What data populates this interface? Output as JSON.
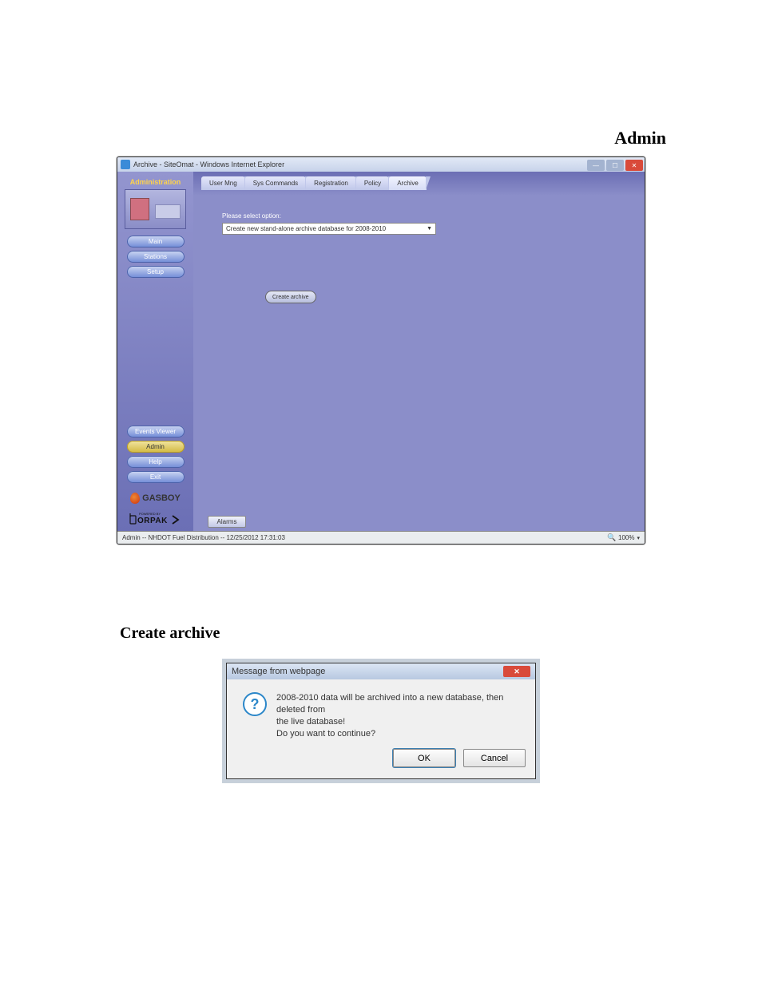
{
  "doc": {
    "section_admin": "Admin",
    "section_create": "Create archive"
  },
  "win": {
    "title": "Archive - SiteOmat - Windows Internet Explorer",
    "sidebar": {
      "heading": "Administration",
      "buttons": {
        "main": "Main",
        "stations": "Stations",
        "setup": "Setup",
        "events": "Events Viewer",
        "admin": "Admin",
        "help": "Help",
        "exit": "Exit"
      },
      "brand": "GASBOY",
      "powered": "POWERED BY",
      "orpak": "ORPAK"
    },
    "tabs": {
      "usermng": "User Mng",
      "syscmd": "Sys Commands",
      "reg": "Registration",
      "policy": "Policy",
      "archive": "Archive"
    },
    "content": {
      "prompt": "Please select option:",
      "dropdown": "Create new stand-alone archive database for 2008-2010",
      "create_btn": "Create archive",
      "alarms": "Alarms"
    },
    "status": {
      "left": "Admin -- NHDOT Fuel Distribution -- 12/25/2012  17:31:03",
      "zoom": "100%"
    }
  },
  "dialog": {
    "title": "Message from webpage",
    "msg_l1": "2008-2010 data will be archived into a new database, then deleted from",
    "msg_l2": "the live database!",
    "msg_l3": "Do you want to continue?",
    "ok": "OK",
    "cancel": "Cancel"
  }
}
